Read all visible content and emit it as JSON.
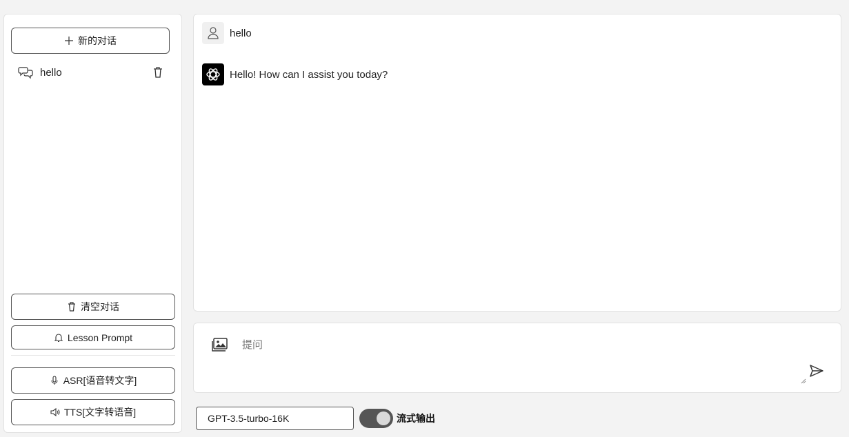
{
  "sidebar": {
    "new_chat_label": "新的对话",
    "conversations": [
      {
        "title": "hello"
      }
    ],
    "clear_label": "清空对话",
    "lesson_label": "Lesson Prompt",
    "asr_label": "ASR[语音转文字]",
    "tts_label": "TTS[文字转语音]"
  },
  "chat": {
    "messages": [
      {
        "role": "user",
        "text": "hello",
        "icon": "user-icon"
      },
      {
        "role": "assistant",
        "text": "Hello! How can I assist you today?",
        "icon": "openai-logo-icon"
      }
    ]
  },
  "input": {
    "placeholder": "提问",
    "value": ""
  },
  "footer": {
    "model": "GPT-3.5-turbo-16K",
    "stream_label": "流式输出",
    "stream_enabled": true
  }
}
